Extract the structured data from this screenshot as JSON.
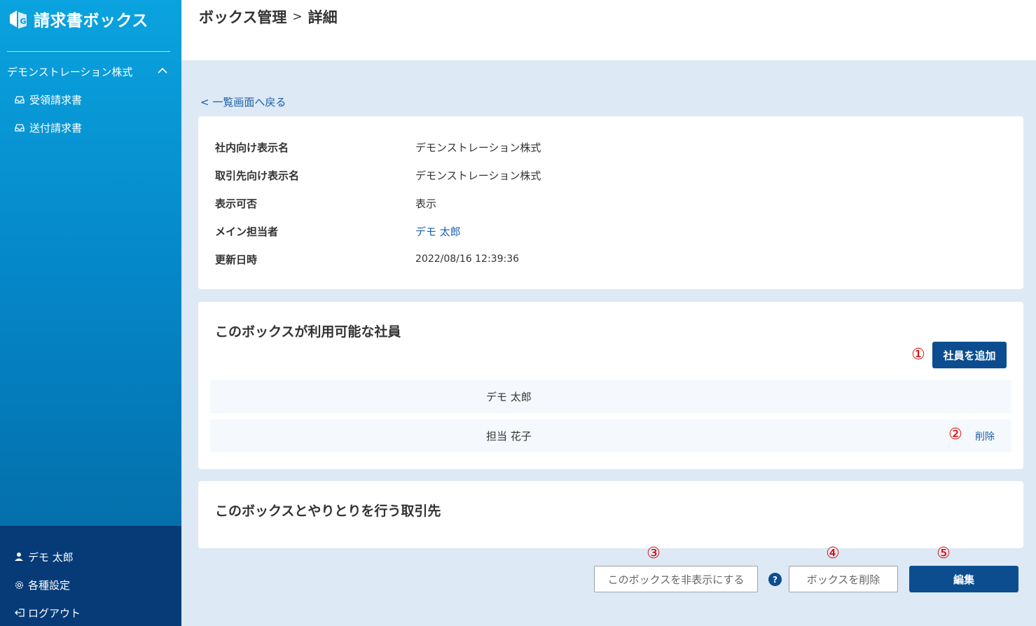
{
  "app": {
    "logo_text": "請求書ボックス"
  },
  "sidebar": {
    "company": "デモンストレーション株式",
    "items": [
      {
        "label": "受領請求書",
        "icon": "inbox-icon"
      },
      {
        "label": "送付請求書",
        "icon": "inbox-icon"
      }
    ],
    "bottom": [
      {
        "label": "デモ 太郎",
        "icon": "user-icon"
      },
      {
        "label": "各種設定",
        "icon": "gear-icon"
      },
      {
        "label": "ログアウト",
        "icon": "logout-icon"
      }
    ]
  },
  "header": {
    "crumb_parent": "ボックス管理",
    "crumb_sep": ">",
    "crumb_current": "詳細"
  },
  "main": {
    "back_link": "< 一覧画面へ戻る",
    "info": [
      {
        "label": "社内向け表示名",
        "value": "デモンストレーション株式"
      },
      {
        "label": "取引先向け表示名",
        "value": "デモンストレーション株式"
      },
      {
        "label": "表示可否",
        "value": "表示"
      },
      {
        "label": "メイン担当者",
        "value": "デモ 太郎"
      },
      {
        "label": "更新日時",
        "value": "2022/08/16 12:39:36"
      }
    ],
    "members": {
      "title": "このボックスが利用可能な社員",
      "add_button": "社員を追加",
      "rows": [
        {
          "name": "デモ 太郎",
          "action": ""
        },
        {
          "name": "担当 花子",
          "action": "削除"
        }
      ]
    },
    "partners": {
      "title": "このボックスとやりとりを行う取引先"
    },
    "actions": {
      "hide_button": "このボックスを非表示にする",
      "help_icon": "?",
      "delete_button": "ボックスを削除",
      "edit_button": "編集"
    },
    "annotations": [
      "①",
      "②",
      "③",
      "④",
      "⑤"
    ]
  },
  "colors": {
    "primary": "#0c4d8f",
    "link": "#1a5fa8",
    "annotation": "#e00000",
    "background": "#dde9f5"
  }
}
